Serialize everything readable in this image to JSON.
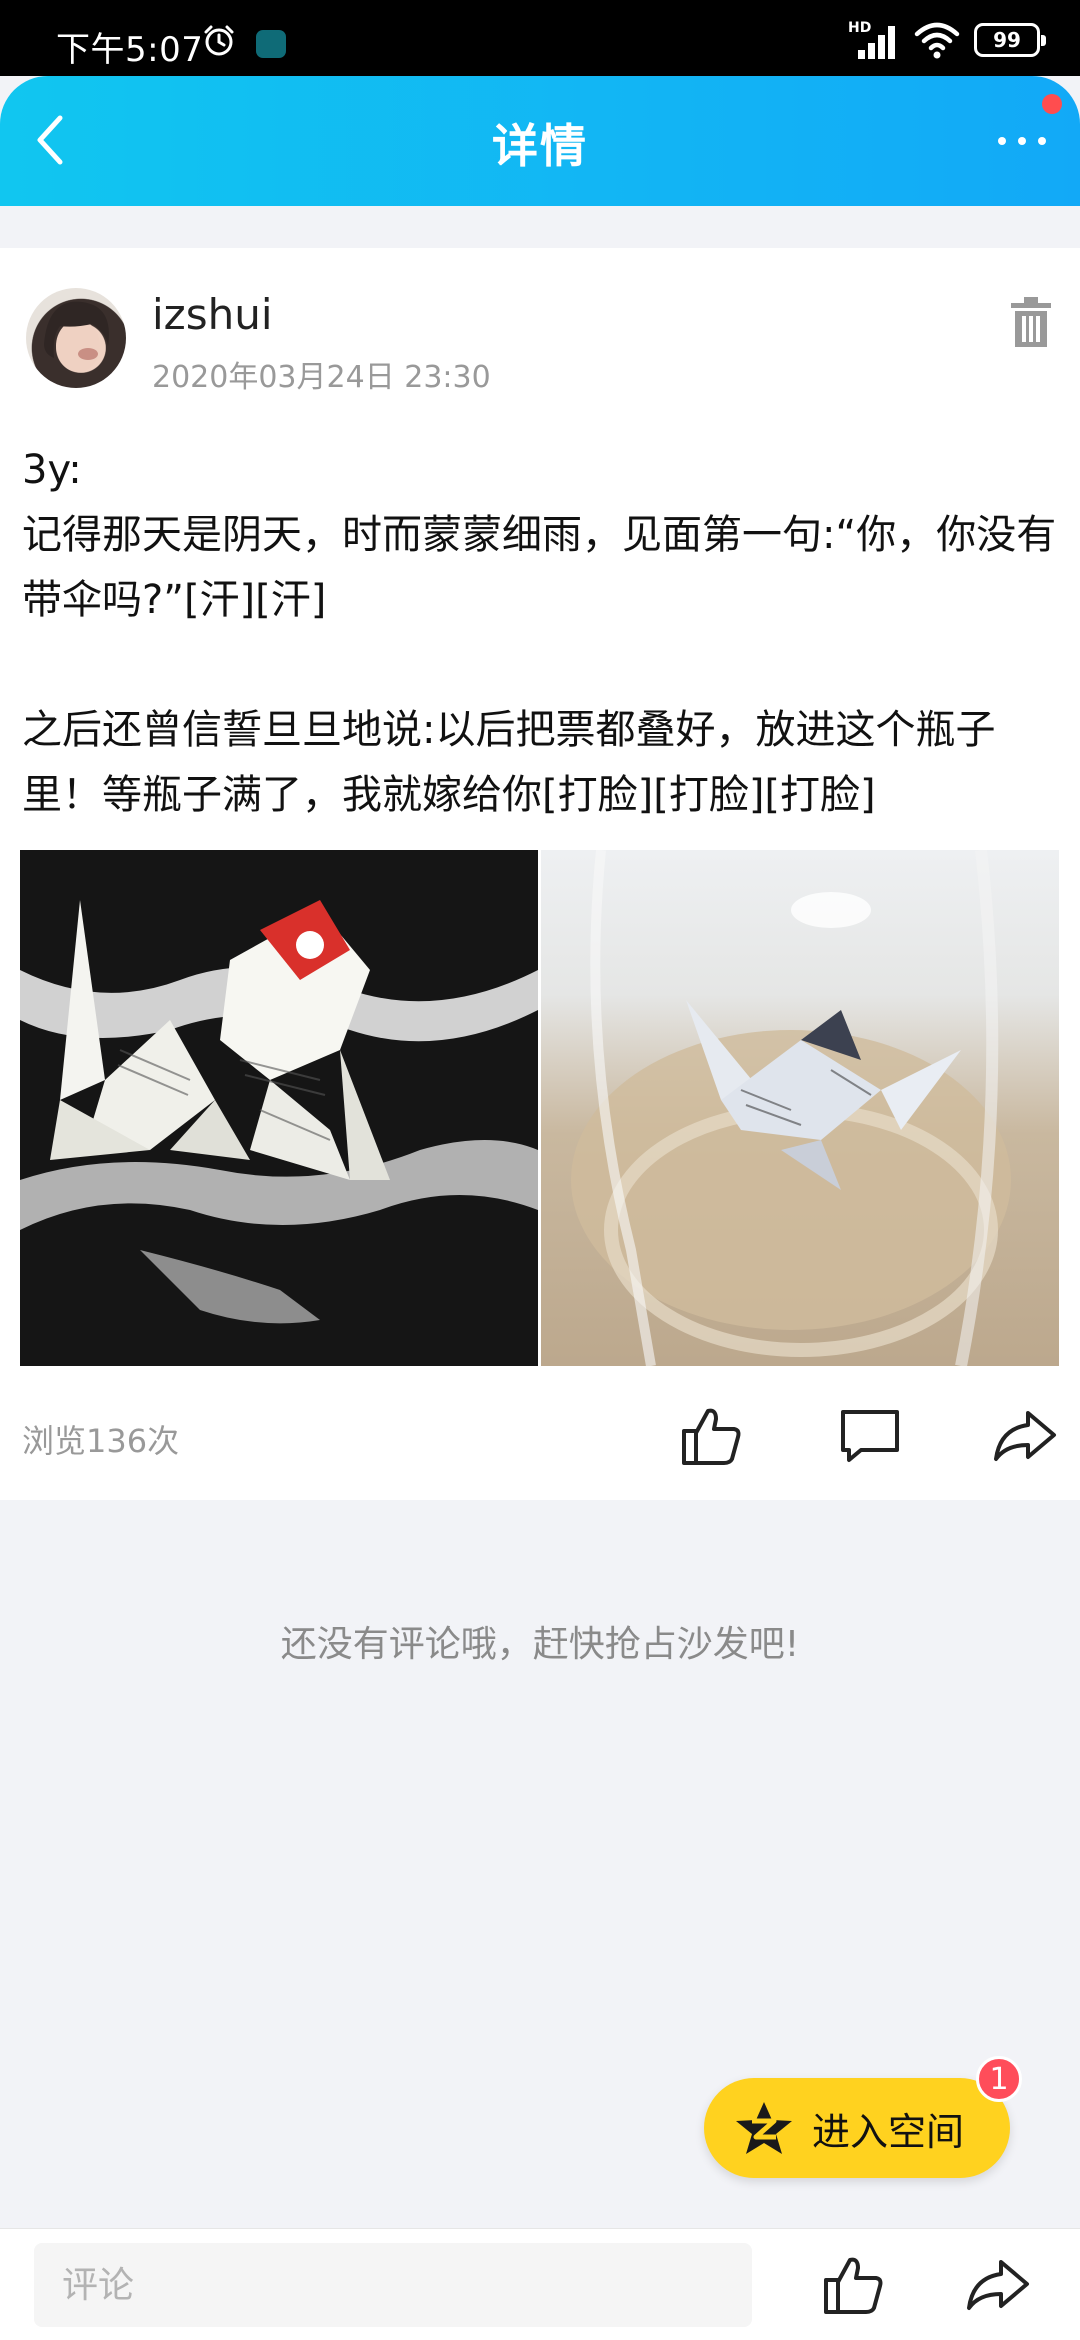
{
  "status_bar": {
    "time": "下午5:07",
    "network": "HD",
    "battery": "99",
    "icons": [
      "alarm-icon",
      "app-notification-icon",
      "signal-icon",
      "wifi-icon",
      "battery-icon"
    ]
  },
  "nav": {
    "title": "详情",
    "back_icon": "back-arrow-icon",
    "more_icon": "more-icon",
    "colors": {
      "gradient_start": "#11c6f0",
      "gradient_end": "#12a9f7",
      "dot": "#ff4d4f"
    }
  },
  "post": {
    "author": "izshui",
    "time": "2020年03月24日 23:30",
    "text": "3y:\n记得那天是阴天，时而蒙蒙细雨，见面第一句:“你，你没有带伞吗?”[汗][汗]\n\n之后还曾信誓旦旦地说:以后把票都叠好，放进这个瓶子里！等瓶子满了，我就嫁给你[打脸][打脸][打脸]",
    "images": [
      "photo-paper-cranes",
      "photo-crane-in-jar"
    ],
    "view_count": "浏览136次"
  },
  "comments": {
    "empty_text": "还没有评论哦，赶快抢占沙发吧!"
  },
  "floating": {
    "label": "进入空间",
    "badge": "1",
    "color": "#ffd21f"
  },
  "bottom_bar": {
    "placeholder": "评论"
  }
}
